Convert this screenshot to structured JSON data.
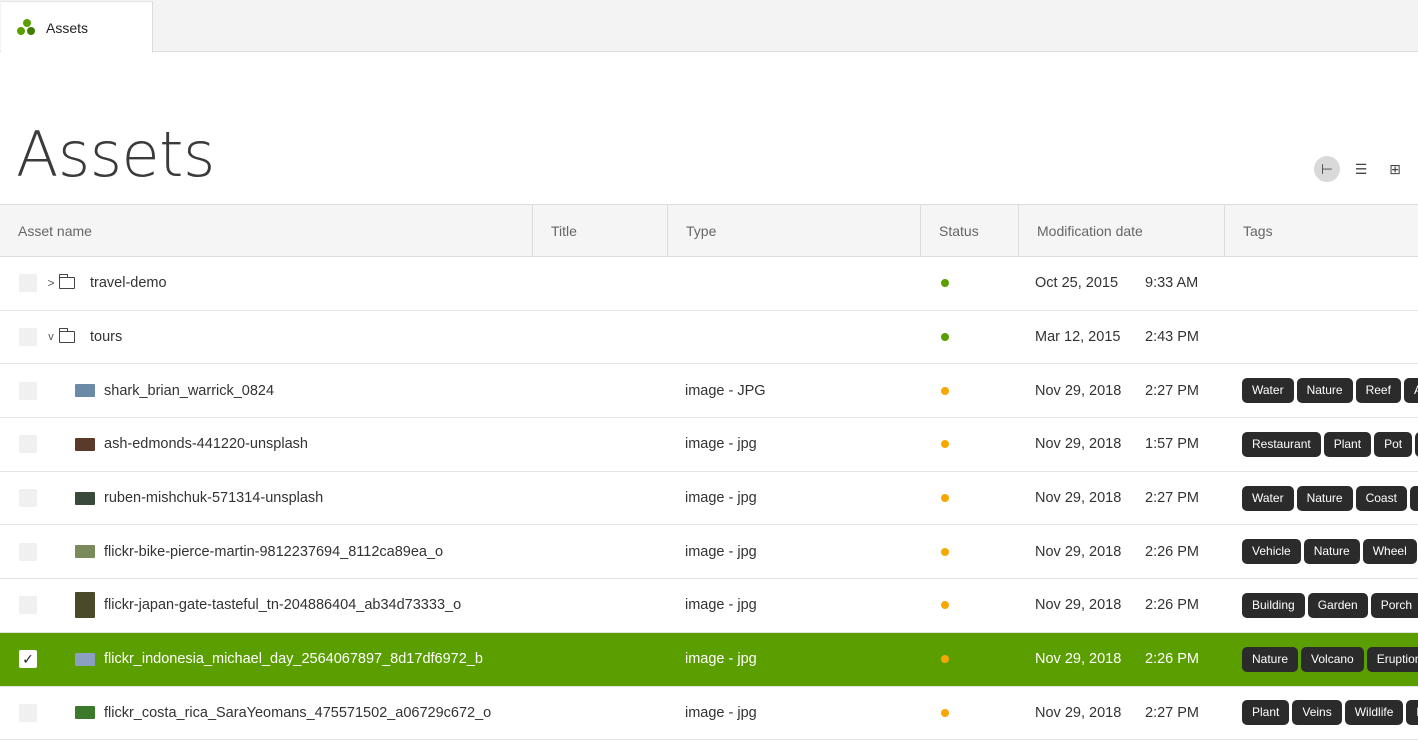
{
  "tab": {
    "label": "Assets"
  },
  "page": {
    "title": "Assets"
  },
  "view_toggles": [
    {
      "name": "column-view-icon",
      "active": true,
      "glyph": "⊢"
    },
    {
      "name": "list-view-icon",
      "active": false,
      "glyph": "☰"
    },
    {
      "name": "grid-view-icon",
      "active": false,
      "glyph": "⊞"
    }
  ],
  "columns": [
    "Asset name",
    "Title",
    "Type",
    "Status",
    "Modification date",
    "Tags"
  ],
  "colors": {
    "accent": "#5a9e00",
    "published": "#5a9e00",
    "draft": "#f6a800"
  },
  "rows": [
    {
      "kind": "folder",
      "expand": ">",
      "name": "travel-demo",
      "title": "",
      "type": "",
      "status": "published",
      "date": "Oct 25, 2015",
      "time": "9:33 AM",
      "tags": [],
      "selected": false
    },
    {
      "kind": "folder",
      "expand": "v",
      "name": "tours",
      "title": "",
      "type": "",
      "status": "published",
      "date": "Mar 12, 2015",
      "time": "2:43 PM",
      "tags": [],
      "selected": false
    },
    {
      "kind": "image",
      "name": "shark_brian_warrick_0824",
      "title": "",
      "type": "image - JPG",
      "status": "draft",
      "date": "Nov 29, 2018",
      "time": "2:27 PM",
      "tags": [
        "Water",
        "Nature",
        "Reef",
        "An"
      ],
      "selected": false,
      "thumb": "#6b8aa8"
    },
    {
      "kind": "image",
      "name": "ash-edmonds-441220-unsplash",
      "title": "",
      "type": "image - jpg",
      "status": "draft",
      "date": "Nov 29, 2018",
      "time": "1:57 PM",
      "tags": [
        "Restaurant",
        "Plant",
        "Pot",
        "I"
      ],
      "selected": false,
      "thumb": "#5a3a2a"
    },
    {
      "kind": "image",
      "name": "ruben-mishchuk-571314-unsplash",
      "title": "",
      "type": "image - jpg",
      "status": "draft",
      "date": "Nov 29, 2018",
      "time": "2:27 PM",
      "tags": [
        "Water",
        "Nature",
        "Coast",
        "I"
      ],
      "selected": false,
      "thumb": "#3a4a3a"
    },
    {
      "kind": "image",
      "name": "flickr-bike-pierce-martin-9812237694_8112ca89ea_o",
      "title": "",
      "type": "image - jpg",
      "status": "draft",
      "date": "Nov 29, 2018",
      "time": "2:26 PM",
      "tags": [
        "Vehicle",
        "Nature",
        "Wheel",
        ""
      ],
      "selected": false,
      "thumb": "#7a8a5a"
    },
    {
      "kind": "image",
      "tall": true,
      "name": "flickr-japan-gate-tasteful_tn-204886404_ab34d73333_o",
      "title": "",
      "type": "image - jpg",
      "status": "draft",
      "date": "Nov 29, 2018",
      "time": "2:26 PM",
      "tags": [
        "Building",
        "Garden",
        "Porch"
      ],
      "selected": false,
      "thumb": "#4a4a2a"
    },
    {
      "kind": "image",
      "name": "flickr_indonesia_michael_day_2564067897_8d17df6972_b",
      "title": "",
      "type": "image - jpg",
      "status": "draft",
      "date": "Nov 29, 2018",
      "time": "2:26 PM",
      "tags": [
        "Nature",
        "Volcano",
        "Eruption"
      ],
      "selected": true,
      "thumb": "#8aa0c0"
    },
    {
      "kind": "image",
      "name": "flickr_costa_rica_SaraYeomans_475571502_a06729c672_o",
      "title": "",
      "type": "image - jpg",
      "status": "draft",
      "date": "Nov 29, 2018",
      "time": "2:27 PM",
      "tags": [
        "Plant",
        "Veins",
        "Wildlife",
        "F"
      ],
      "selected": false,
      "thumb": "#3a7a2a"
    }
  ]
}
